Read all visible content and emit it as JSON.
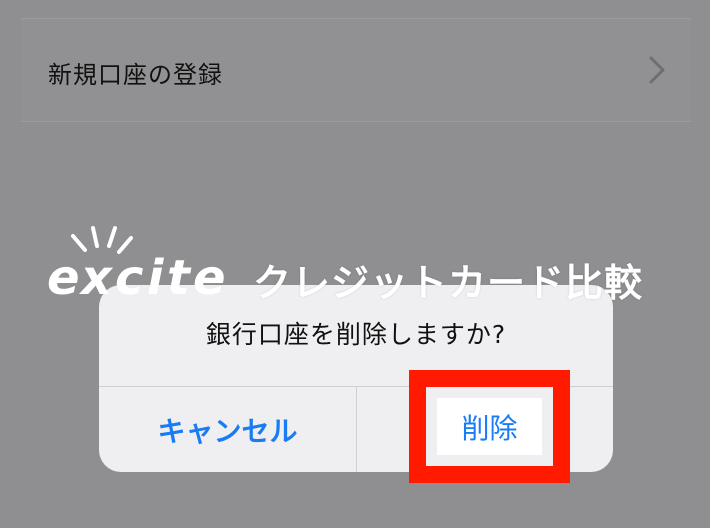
{
  "list": {
    "row_label": "新規口座の登録"
  },
  "watermark": {
    "logo": "excite",
    "text": "クレジットカード比較"
  },
  "dialog": {
    "title": "銀行口座を削除しますか?",
    "cancel_label": "キャンセル",
    "delete_label": "削除"
  },
  "colors": {
    "accent": "#1a7cf5",
    "highlight": "#ff1a00",
    "dim_background": "#8f8f91",
    "dialog_background": "#efeff1"
  }
}
